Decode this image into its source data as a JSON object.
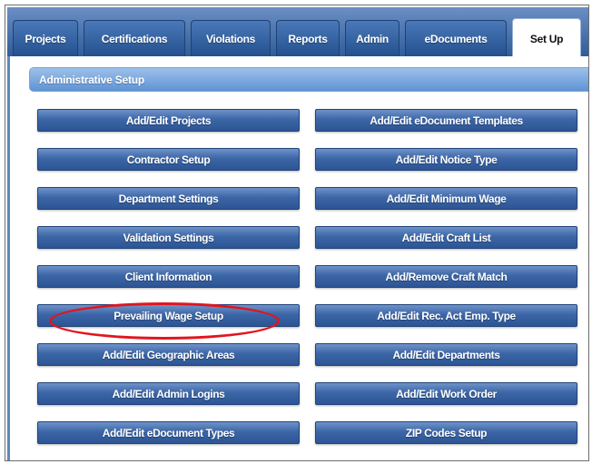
{
  "tabs": [
    {
      "label": "Projects",
      "active": false
    },
    {
      "label": "Certifications",
      "active": false
    },
    {
      "label": "Violations",
      "active": false
    },
    {
      "label": "Reports",
      "active": false
    },
    {
      "label": "Admin",
      "active": false
    },
    {
      "label": "eDocuments",
      "active": false
    },
    {
      "label": "Set Up",
      "active": true
    }
  ],
  "section": {
    "title": "Administrative Setup"
  },
  "buttons": {
    "left": [
      "Add/Edit Projects",
      "Contractor Setup",
      "Department Settings",
      "Validation Settings",
      "Client Information",
      "Prevailing Wage Setup",
      "Add/Edit Geographic Areas",
      "Add/Edit Admin Logins",
      "Add/Edit eDocument Types"
    ],
    "right": [
      "Add/Edit eDocument Templates",
      "Add/Edit Notice Type",
      "Add/Edit Minimum Wage",
      "Add/Edit Craft List",
      "Add/Remove Craft Match",
      "Add/Edit Rec. Act Emp. Type",
      "Add/Edit Departments",
      "Add/Edit Work Order",
      "ZIP Codes Setup"
    ]
  },
  "annotation": {
    "highlighted_button": "Prevailing Wage Setup",
    "ring_color": "#e0161f"
  },
  "colors": {
    "tab_bar": "#2f5b99",
    "button": "#3c66a6",
    "header": "#5f93d3"
  }
}
